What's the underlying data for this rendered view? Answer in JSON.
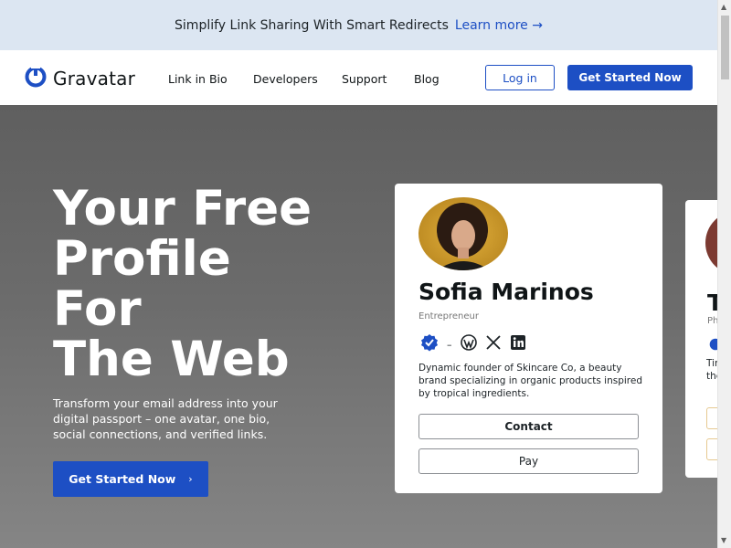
{
  "banner": {
    "text": "Simplify Link Sharing With Smart Redirects",
    "link": "Learn more →"
  },
  "nav": {
    "logo": "Gravatar",
    "links": [
      "Link in Bio",
      "Developers",
      "Support",
      "Blog"
    ],
    "login": "Log in",
    "get_started": "Get Started Now"
  },
  "hero": {
    "title_lines": [
      "Your Free",
      "Profile",
      "For",
      "The Web"
    ],
    "description": "Transform your email address into your digital passport – one avatar, one bio, social connections, and verified links.",
    "cta": "Get Started Now",
    "cta_chevron": "›"
  },
  "card": {
    "name": "Sofia Marinos",
    "role": "Entrepreneur",
    "icons": [
      "verified-badge-icon",
      "wordpress-icon",
      "x-icon",
      "linkedin-icon"
    ],
    "separator": "–",
    "bio": "Dynamic founder of Skincare Co, a beauty brand specializing in organic products inspired by tropical ingredients.",
    "contact": "Contact",
    "pay": "Pay"
  },
  "card2": {
    "name_partial": "T",
    "role_partial": "Ph",
    "bio_partial_1": "Tir",
    "bio_partial_2": "the"
  },
  "colors": {
    "accent": "#1d4fc4",
    "banner_bg": "#dce6f2"
  }
}
